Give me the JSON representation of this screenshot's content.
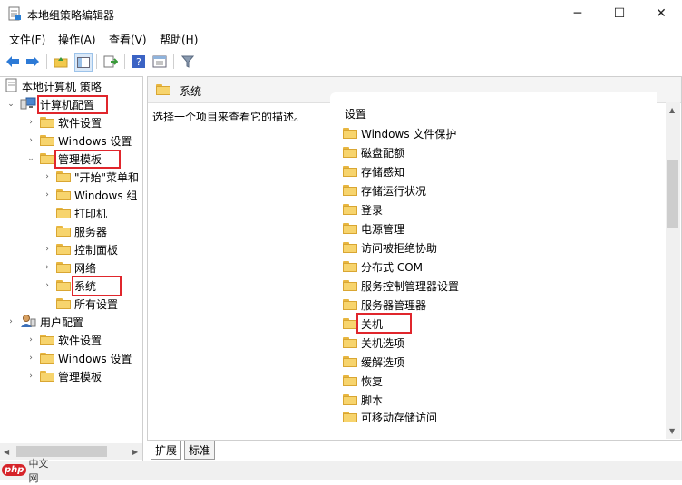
{
  "window": {
    "title": "本地组策略编辑器",
    "minimize": "─",
    "maximize": "☐",
    "close": "✕"
  },
  "menu": [
    "文件(F)",
    "操作(A)",
    "查看(V)",
    "帮助(H)"
  ],
  "tree": {
    "root": "本地计算机 策略",
    "computer_config": "计算机配置",
    "cc_software": "软件设置",
    "cc_windows": "Windows 设置",
    "cc_admin": "管理模板",
    "start_menu": "\"开始\"菜单和",
    "windows_components": "Windows 组",
    "printers": "打印机",
    "servers": "服务器",
    "control_panel": "控制面板",
    "network": "网络",
    "system": "系统",
    "all_settings": "所有设置",
    "user_config": "用户配置",
    "uc_software": "软件设置",
    "uc_windows": "Windows 设置",
    "uc_admin": "管理模板"
  },
  "right": {
    "header": "系统",
    "description": "选择一个项目来查看它的描述。",
    "settings_header": "设置",
    "items": [
      "Windows 文件保护",
      "磁盘配额",
      "存储感知",
      "存储运行状况",
      "登录",
      "电源管理",
      "访问被拒绝协助",
      "分布式 COM",
      "服务控制管理器设置",
      "服务器管理器",
      "关机",
      "关机选项",
      "缓解选项",
      "恢复",
      "脚本",
      "可移动存储访问"
    ]
  },
  "tabs": [
    "扩展",
    "标准"
  ],
  "watermark": {
    "logo": "php",
    "text": "中文网"
  },
  "colors": {
    "highlight": "#e0262c",
    "folder": "#f7d46d",
    "accent": "#1e6fd9"
  }
}
